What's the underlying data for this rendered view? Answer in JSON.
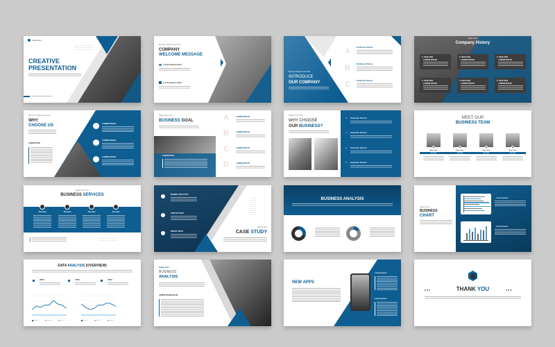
{
  "colors": {
    "background": "#cbcbcb",
    "accent": "#0e5e92",
    "dark": "#2a2a2a"
  },
  "slides": [
    {
      "logo": "Logo Here",
      "title_1": "CREATIVE",
      "title_2": "PRESENTATION"
    },
    {
      "tagline": "Business Tagline Goes Here",
      "title_1": "COMPANY",
      "title_2": "WELCOME MESSAGE",
      "items": [
        "Lorem Ipsum dolor",
        "Lorem Ipsum dolor"
      ]
    },
    {
      "tagline": "Business Tagline Goes Here",
      "title_1": "INTRODUCE",
      "title_2": "OUR COMPANY",
      "letters": [
        "A",
        "B",
        "C"
      ],
      "employees": [
        "Employee Name",
        "Employee Name",
        "Employee Name"
      ]
    },
    {
      "tagline": "Tagline Here",
      "title": "Company History",
      "boxes": [
        {
          "year": "1. 2020-2021",
          "label": "LOREM IPSUM"
        },
        {
          "year": "2. 2020-2021",
          "label": "LOREM IPSUM"
        },
        {
          "year": "3. 2020-2021",
          "label": "LOREM IPSUM"
        },
        {
          "year": "4. 2020-2021",
          "label": "LOREM IPSUM"
        },
        {
          "year": "5. 2020-2021",
          "label": "LOREM IPSUM"
        },
        {
          "year": "6. 2020-2021",
          "label": "LOREM IPSUM"
        }
      ]
    },
    {
      "tagline": "Business Tagline Goes Here",
      "title_1": "WHY",
      "title_2": "CHOOSE US",
      "sub": "CONCEPTION",
      "items": [
        "LOREM IPSUM",
        "LOREM IPSUM",
        "LOREM IPSUM"
      ]
    },
    {
      "tagline": "Tagline Goes Here",
      "title_1": "BUSINESS",
      "title_2": "GOAL",
      "sub": "CONCEPTION",
      "letters": [
        "A",
        "B",
        "C",
        "D"
      ],
      "items": [
        "LOREM IPSUM",
        "LOREM IPSUM",
        "LOREM IPSUM",
        "LOREM IPSUM"
      ]
    },
    {
      "tagline": "Tagline Goes Here",
      "title_1": "WHY CHOOSE",
      "title_2a": "OUR ",
      "title_2b": "BUSINESS?",
      "items": [
        "Customer Service",
        "Customer Service",
        "Customer Service",
        "Customer Service"
      ]
    },
    {
      "title_1": "MEET OUR",
      "title_2": "BUSINESS TEAM",
      "members": [
        {
          "name": "Name Here",
          "job": "Job Title"
        },
        {
          "name": "Name Here",
          "job": "Job Title"
        },
        {
          "name": "Name Here",
          "job": "Job Title"
        },
        {
          "name": "Name Here",
          "job": "Job Title"
        }
      ]
    },
    {
      "tagline": "Tagline Goes Here",
      "title_1": "BUSINESS ",
      "title_2": "SERVICES",
      "items": [
        "Text Here",
        "Text Here",
        "Text Here",
        "Text Here"
      ]
    },
    {
      "items": [
        "MARKET ANALYTICS",
        "HOW TO START",
        "BRIGHT IDEAS"
      ],
      "tagline": "Tagline Here",
      "title_1": "CASE ",
      "title_2": "STUDY"
    },
    {
      "title": "BUSINESS ANALYSIS",
      "donut_values": [
        30,
        15
      ]
    },
    {
      "tagline": "Tagline Here",
      "title_1": "BUSINESS",
      "title_2": "CHART",
      "items": [
        "Lorem Ipsum",
        "Lorem Ipsum"
      ]
    },
    {
      "title_1": "DATA ",
      "title_2": "ANALYSIS",
      "title_3": " (OVERVIEW)",
      "stats": [
        "2000",
        "1500",
        "2700"
      ],
      "legend": [
        "Series 1",
        "Series 2",
        "Series 3"
      ]
    },
    {
      "tagline": "Tagline Here",
      "title_1": "BUSINESS",
      "title_2": "ANALYSIS",
      "sub": "LOREM IPSUM DOLOR"
    },
    {
      "title": "NEW APPS",
      "items": [
        "Lorem Ipsum",
        "Lorem Ipsum"
      ]
    },
    {
      "title_1": "THANK ",
      "title_2": "YOU",
      "arrows_left": "▸ ▸ ▸",
      "arrows_right": "◂ ◂ ◂"
    }
  ]
}
